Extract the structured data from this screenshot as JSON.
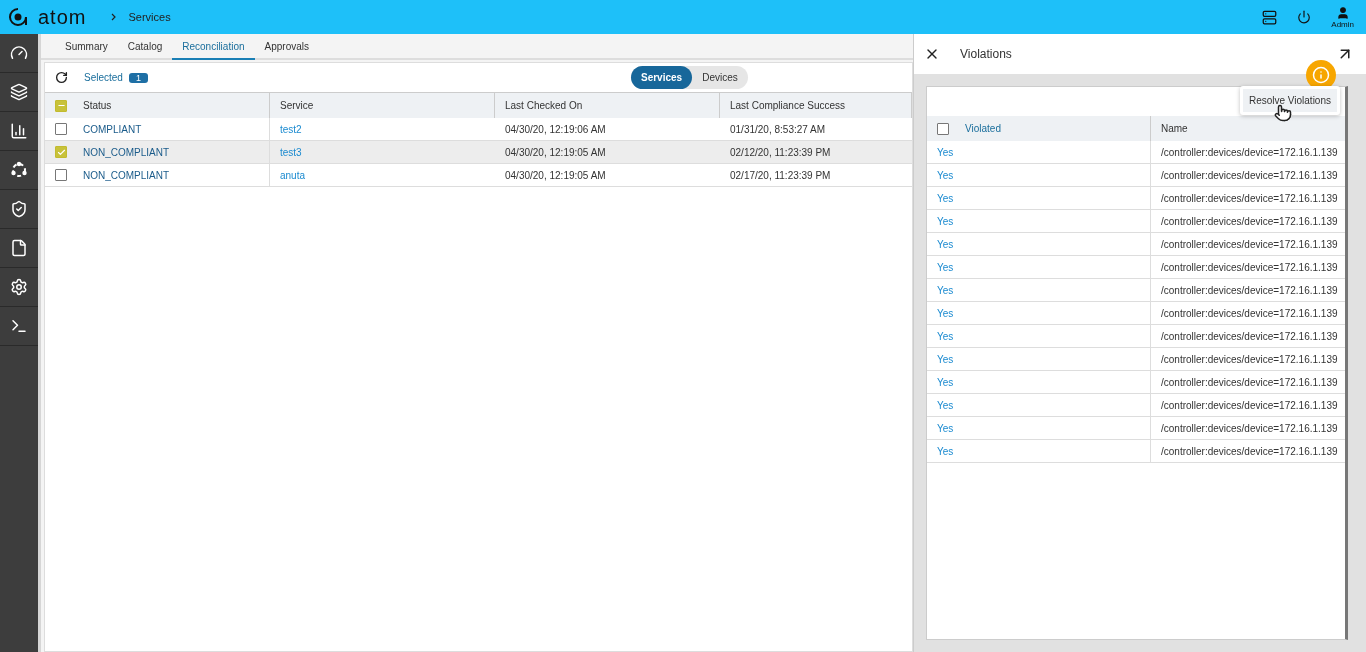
{
  "header": {
    "logo": "atom",
    "breadcrumb": "Services",
    "user": "Admin"
  },
  "sidebar": {
    "items": [
      {
        "kind": "gauge"
      },
      {
        "kind": "cards"
      },
      {
        "kind": "chart"
      },
      {
        "kind": "network"
      },
      {
        "kind": "shield"
      },
      {
        "kind": "file"
      },
      {
        "kind": "gear"
      },
      {
        "kind": "terminal"
      }
    ]
  },
  "tabs": [
    {
      "label": "Summary",
      "selected": false
    },
    {
      "label": "Catalog",
      "selected": false
    },
    {
      "label": "Reconciliation",
      "selected": true
    },
    {
      "label": "Approvals",
      "selected": false
    }
  ],
  "toolbar": {
    "selected_label": "Selected",
    "selected_count": "1",
    "toggle": [
      {
        "label": "Services",
        "selected": true
      },
      {
        "label": "Devices",
        "selected": false
      }
    ]
  },
  "table": {
    "select_all_indeterminate": true,
    "columns": [
      "Status",
      "Service",
      "Last Checked On",
      "Last Compliance Success"
    ],
    "rows": [
      {
        "checked": false,
        "cells": [
          "COMPLIANT",
          "test2",
          "04/30/20, 12:19:06 AM",
          "01/31/20, 8:53:27 AM"
        ]
      },
      {
        "checked": true,
        "cells": [
          "NON_COMPLIANT",
          "test3",
          "04/30/20, 12:19:05 AM",
          "02/12/20, 11:23:39 PM"
        ]
      },
      {
        "checked": false,
        "cells": [
          "NON_COMPLIANT",
          "anuta",
          "04/30/20, 12:19:05 AM",
          "02/17/20, 11:23:39 PM"
        ]
      }
    ]
  },
  "panel": {
    "title": "Violations",
    "tooltip": "Resolve Violations",
    "select_all_checked": false,
    "columns": [
      "Violated",
      "Name"
    ],
    "rows": [
      [
        "Yes",
        "/controller:devices/device=172.16.1.139"
      ],
      [
        "Yes",
        "/controller:devices/device=172.16.1.139"
      ],
      [
        "Yes",
        "/controller:devices/device=172.16.1.139"
      ],
      [
        "Yes",
        "/controller:devices/device=172.16.1.139"
      ],
      [
        "Yes",
        "/controller:devices/device=172.16.1.139"
      ],
      [
        "Yes",
        "/controller:devices/device=172.16.1.139"
      ],
      [
        "Yes",
        "/controller:devices/device=172.16.1.139"
      ],
      [
        "Yes",
        "/controller:devices/device=172.16.1.139"
      ],
      [
        "Yes",
        "/controller:devices/device=172.16.1.139"
      ],
      [
        "Yes",
        "/controller:devices/device=172.16.1.139"
      ],
      [
        "Yes",
        "/controller:devices/device=172.16.1.139"
      ],
      [
        "Yes",
        "/controller:devices/device=172.16.1.139"
      ],
      [
        "Yes",
        "/controller:devices/device=172.16.1.139"
      ],
      [
        "Yes",
        "/controller:devices/device=172.16.1.139"
      ]
    ]
  }
}
